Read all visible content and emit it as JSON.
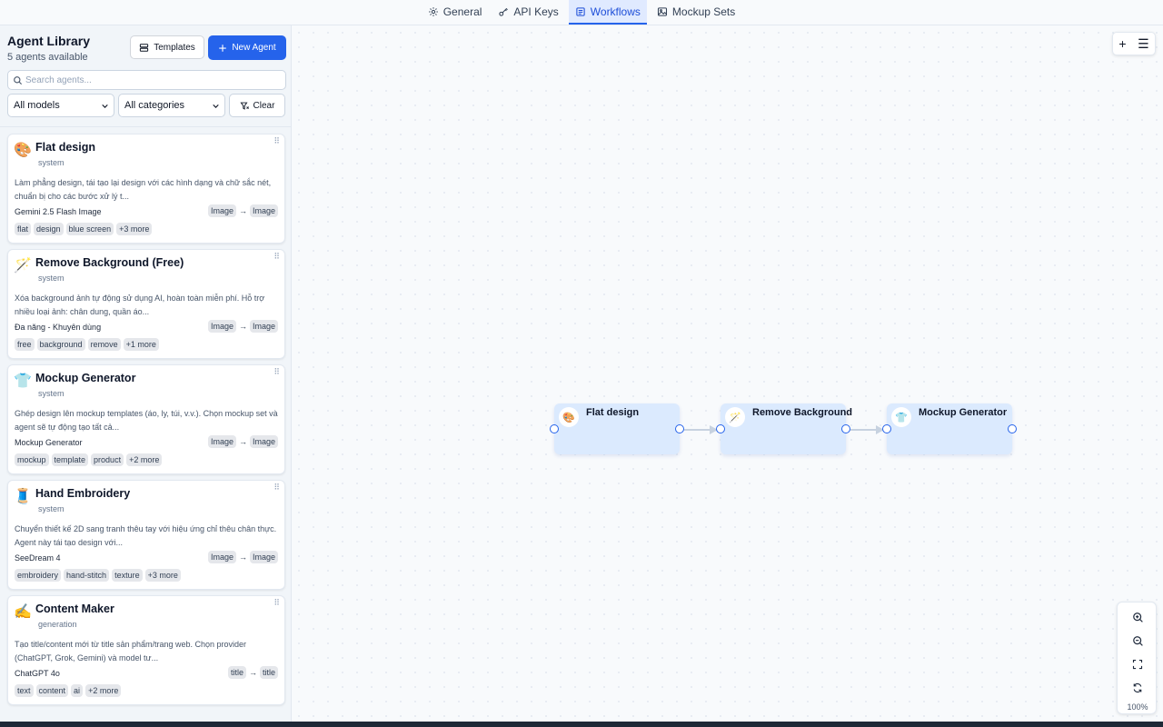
{
  "nav": {
    "tabs": [
      {
        "label": "General",
        "icon": "gear-icon"
      },
      {
        "label": "API Keys",
        "icon": "key-icon"
      },
      {
        "label": "Workflows",
        "icon": "workflow-icon",
        "active": true
      },
      {
        "label": "Mockup Sets",
        "icon": "image-icon"
      }
    ]
  },
  "sidebar": {
    "title": "Agent Library",
    "subtitle": "5 agents available",
    "templates_label": "Templates",
    "new_agent_label": "New Agent",
    "search_placeholder": "Search agents...",
    "models_select": "All models",
    "categories_select": "All categories",
    "clear_label": "Clear",
    "agents": [
      {
        "emoji": "🎨",
        "name": "Flat design",
        "category": "system",
        "description": "Làm phẳng design, tái tạo lại design với các hình dạng và chữ sắc nét, chuẩn bị cho các bước xử lý t...",
        "model": "Gemini 2.5 Flash Image",
        "input": "Image",
        "output": "Image",
        "tags": [
          "flat",
          "design",
          "blue screen",
          "+3 more"
        ]
      },
      {
        "emoji": "🪄",
        "name": "Remove Background (Free)",
        "category": "system",
        "description": "Xóa background ảnh tự động sử dụng AI, hoàn toàn miễn phí. Hỗ trợ nhiều loại ảnh: chân dung, quần áo...",
        "model": "Đa năng - Khuyên dùng",
        "input": "Image",
        "output": "Image",
        "tags": [
          "free",
          "background",
          "remove",
          "+1 more"
        ]
      },
      {
        "emoji": "👕",
        "name": "Mockup Generator",
        "category": "system",
        "description": "Ghép design lên mockup templates (áo, ly, túi, v.v.). Chọn mockup set và agent sẽ tự động tạo tất cả...",
        "model": "Mockup Generator",
        "input": "Image",
        "output": "Image",
        "tags": [
          "mockup",
          "template",
          "product",
          "+2 more"
        ]
      },
      {
        "emoji": "🧵",
        "name": "Hand Embroidery",
        "category": "system",
        "description": "Chuyển thiết kế 2D sang tranh thêu tay với hiệu ứng chỉ thêu chân thực. Agent này tái tạo design với...",
        "model": "SeeDream 4",
        "input": "Image",
        "output": "Image",
        "tags": [
          "embroidery",
          "hand-stitch",
          "texture",
          "+3 more"
        ]
      },
      {
        "emoji": "✍️",
        "name": "Content Maker",
        "category": "generation",
        "description": "Tạo title/content mới từ title sản phẩm/trang web. Chọn provider (ChatGPT, Grok, Gemini) và model tư...",
        "model": "ChatGPT 4o",
        "input": "title",
        "output": "title",
        "tags": [
          "text",
          "content",
          "ai",
          "+2 more"
        ]
      }
    ]
  },
  "canvas": {
    "zoom": "100%",
    "nodes": [
      {
        "emoji": "🎨",
        "title": "Flat design"
      },
      {
        "emoji": "🪄",
        "title": "Remove Background"
      },
      {
        "emoji": "👕",
        "title": "Mockup Generator"
      }
    ]
  },
  "colors": {
    "accent": "#2563eb",
    "node_bg": "#dbeafe",
    "active_tab_bg": "#e0eaff"
  }
}
